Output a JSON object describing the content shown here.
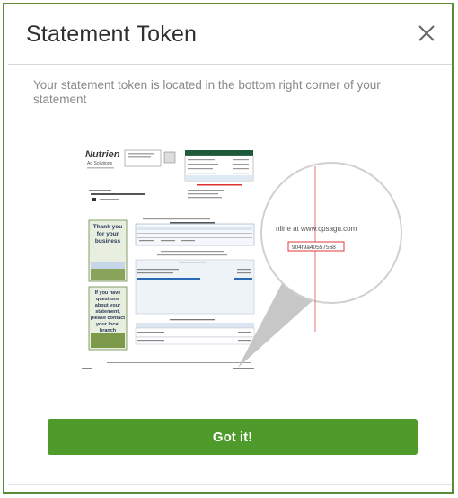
{
  "dialog": {
    "title": "Statement Token",
    "subtitle": "Your statement token is located in the bottom right corner of your statement",
    "confirm_label": "Got it!"
  },
  "statement_preview": {
    "brand": "Nutrien",
    "brand_sub": "Ag Solutions",
    "left_panel_top": "Thank you for your business",
    "left_panel_bottom": "If you have questions about your statement, please contact your local branch",
    "callout_url_text": "nline at www.cpsagu.com",
    "callout_token": "904f9a40557568"
  },
  "colors": {
    "accent_green": "#4e9a2a",
    "frame_green": "#5a8a3a",
    "token_red": "#e03a3a"
  }
}
